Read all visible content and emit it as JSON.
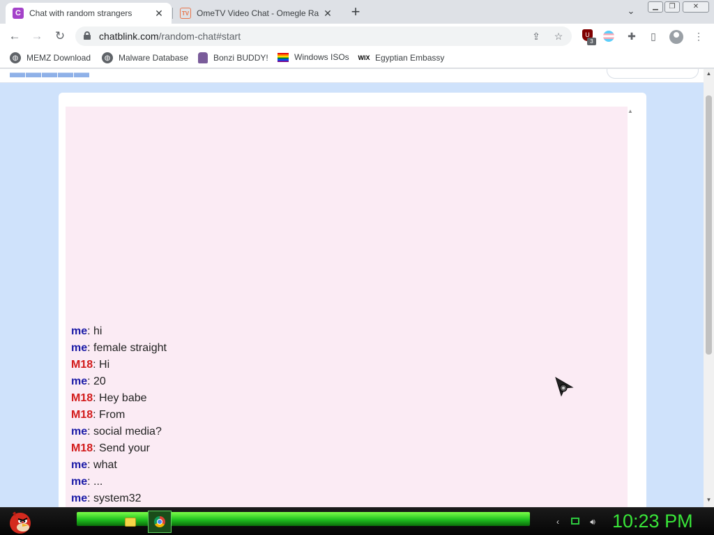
{
  "tabs": [
    {
      "title": "Chat with random strangers",
      "favicon": "C",
      "active": true
    },
    {
      "title": "OmeTV Video Chat - Omegle Ra",
      "favicon": "TV",
      "active": false
    }
  ],
  "toolbar": {
    "url_host": "chatblink.com",
    "url_path": "/random-chat#start",
    "extension_badge": "3"
  },
  "bookmarks": [
    {
      "label": "MEMZ Download",
      "icon": "globe-icon"
    },
    {
      "label": "Malware Database",
      "icon": "globe-icon"
    },
    {
      "label": "Bonzi BUDDY!",
      "icon": "bonzi-icon"
    },
    {
      "label": "Windows ISOs",
      "icon": "rainbow-flag-icon"
    },
    {
      "label": "Egyptian Embassy",
      "icon": "wix-icon"
    }
  ],
  "chat": {
    "messages": [
      {
        "sender": "me",
        "text": ": hi"
      },
      {
        "sender": "me",
        "text": ": female straight"
      },
      {
        "sender": "M18",
        "text": ": Hi"
      },
      {
        "sender": "me",
        "text": ": 20"
      },
      {
        "sender": "M18",
        "text": ": Hey babe"
      },
      {
        "sender": "M18",
        "text": ": From"
      },
      {
        "sender": "me",
        "text": ": social media?"
      },
      {
        "sender": "M18",
        "text": ": Send your"
      },
      {
        "sender": "me",
        "text": ": what"
      },
      {
        "sender": "me",
        "text": ": ..."
      },
      {
        "sender": "me",
        "text": ": system32"
      }
    ]
  },
  "taskbar": {
    "clock": "10:23 PM"
  },
  "colors": {
    "me": "#1a1aa6",
    "stranger": "#d21a1a",
    "chat_bg": "#fbebf4",
    "page_bg": "#cfe2fb",
    "clock": "#39e639"
  }
}
